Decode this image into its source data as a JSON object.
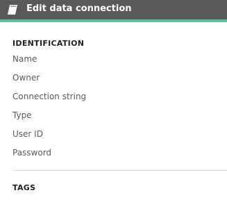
{
  "dialog": {
    "title": "Edit data connection",
    "icon": "data-connection-icon"
  },
  "colors": {
    "header_bg": "#595959",
    "accent": "#5cbf9e",
    "label": "#595959",
    "heading": "#1f1f1f"
  },
  "identification": {
    "heading": "IDENTIFICATION",
    "fields": [
      {
        "label": "Name"
      },
      {
        "label": "Owner"
      },
      {
        "label": "Connection string"
      },
      {
        "label": "Type"
      },
      {
        "label": "User ID"
      },
      {
        "label": "Password"
      }
    ]
  },
  "tags": {
    "heading": "TAGS"
  }
}
